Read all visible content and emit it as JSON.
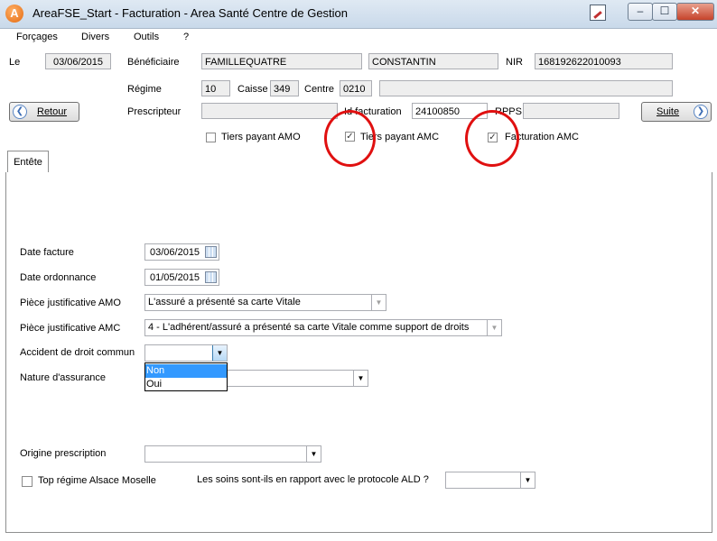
{
  "window": {
    "title": "AreaFSE_Start - Facturation - Area Santé Centre de Gestion",
    "app_icon_letter": "A"
  },
  "menu": [
    "Forçages",
    "Divers",
    "Outils",
    "?"
  ],
  "header": {
    "le_label": "Le",
    "le_value": "03/06/2015",
    "beneficiaire_label": "Bénéficiaire",
    "beneficiaire_nom": "FAMILLEQUATRE",
    "beneficiaire_prenom": "CONSTANTIN",
    "nir_label": "NIR",
    "nir_value": "168192622010093",
    "regime_label": "Régime",
    "regime_value": "10",
    "caisse_label": "Caisse",
    "caisse_value": "349",
    "centre_label": "Centre",
    "centre_value": "0210",
    "prescripteur_label": "Prescripteur",
    "prescripteur_value": "",
    "id_facturation_label": "Id facturation",
    "id_facturation_value": "24100850",
    "rpps_label": "RPPS",
    "rpps_value": "",
    "retour_label": "Retour",
    "suite_label": "Suite",
    "tiers_payant_amo": {
      "label": "Tiers payant AMO",
      "checked": false
    },
    "tiers_payant_amc": {
      "label": "Tiers payant AMC",
      "checked": true
    },
    "facturation_amc": {
      "label": "Facturation AMC",
      "checked": true
    }
  },
  "tabs": [
    {
      "label": "Entête",
      "active": true
    }
  ],
  "form": {
    "date_facture_label": "Date facture",
    "date_facture_value": "03/06/2015",
    "date_ordonnance_label": "Date ordonnance",
    "date_ordonnance_value": "01/05/2015",
    "piece_amo_label": "Pièce justificative AMO",
    "piece_amo_value": "L'assuré a présenté sa carte Vitale",
    "piece_amc_label": "Pièce justificative AMC",
    "piece_amc_value": "4 - L'adhérent/assuré a présenté sa carte Vitale comme support de droits",
    "accident_label": "Accident de droit commun",
    "accident_value": "",
    "accident_options": [
      "Non",
      "Oui"
    ],
    "nature_label": "Nature d'assurance",
    "nature_value": "",
    "origine_label": "Origine prescription",
    "origine_value": "",
    "alsace_label": "Top régime Alsace Moselle",
    "alsace_checked": false,
    "ald_label": "Les soins sont-ils en rapport avec le protocole ALD ?",
    "ald_value": ""
  },
  "colors": {
    "annotation_circle": "#e01010",
    "selected_option": "#3399ff"
  },
  "icons": [
    "app-logo-icon",
    "minimize-icon",
    "maximize-icon",
    "close-icon",
    "chevron-left-icon",
    "chevron-right-icon",
    "calendar-icon",
    "dropdown-arrow-icon",
    "checkmark-icon"
  ]
}
